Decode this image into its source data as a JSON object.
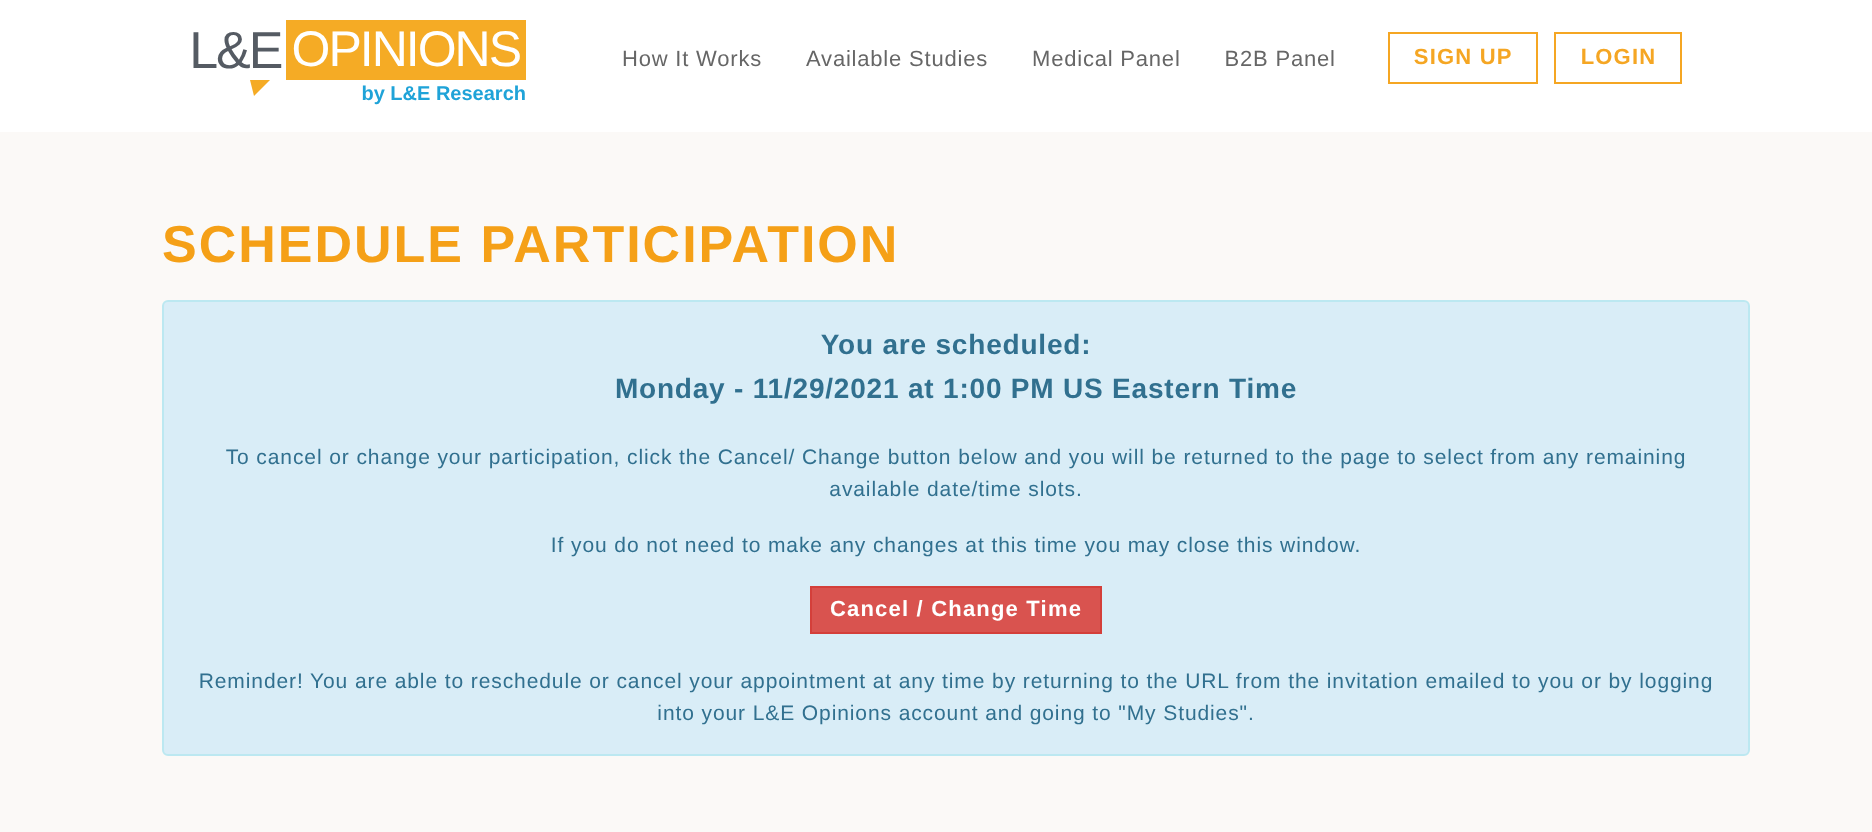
{
  "logo": {
    "brand": "L&E",
    "name": "OPINIONS",
    "tagline": "by L&E Research"
  },
  "nav": [
    "How It Works",
    "Available Studies",
    "Medical Panel",
    "B2B Panel"
  ],
  "auth_buttons": [
    "SIGN UP",
    "LOGIN"
  ],
  "page_title": "SCHEDULE PARTICIPATION",
  "notice": {
    "heading": "You are scheduled:",
    "appointment": "Monday - 11/29/2021 at 1:00 PM US Eastern Time",
    "instructions": "To cancel or change your participation, click the Cancel/ Change button below and you will be returned to the page to select from any remaining available date/time slots.",
    "close_note": "If you do not need to make any changes at this time you may close this window.",
    "button": "Cancel / Change Time",
    "reminder": "Reminder! You are able to reschedule or cancel your appointment at any time by returning to the URL from the invitation emailed to you or by logging into your L&E Opinions account and going to \"My Studies\"."
  }
}
